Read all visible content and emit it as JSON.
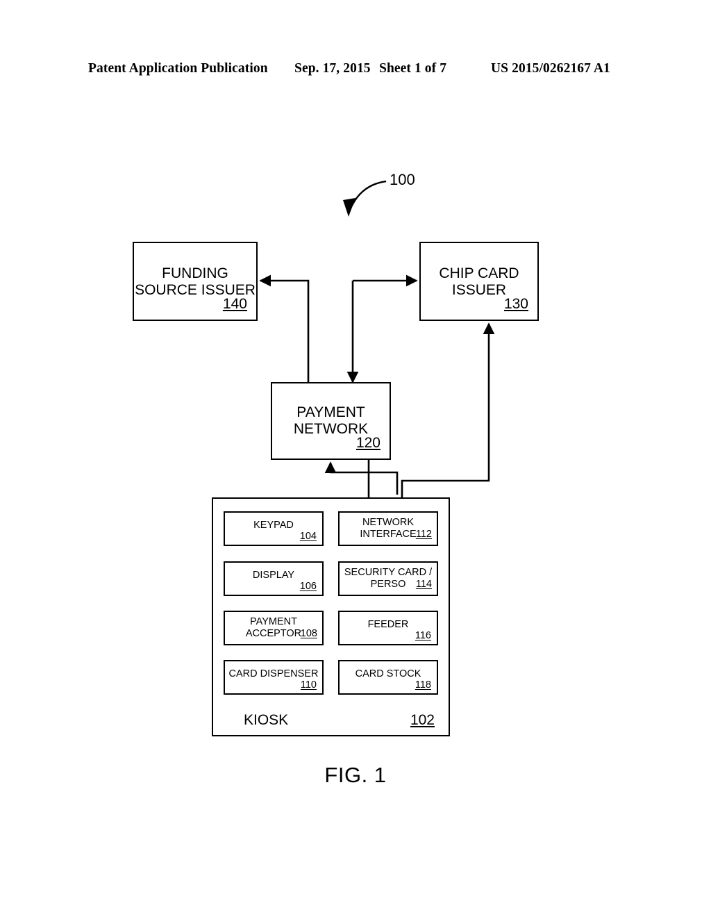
{
  "header": {
    "publication": "Patent Application Publication",
    "date": "Sep. 17, 2015",
    "sheet": "Sheet 1 of 7",
    "number": "US 2015/0262167 A1"
  },
  "figure": {
    "caption": "FIG. 1",
    "system_callout": "100"
  },
  "blocks": {
    "funding_source_issuer": {
      "label": "FUNDING\nSOURCE ISSUER",
      "ref": "140"
    },
    "chip_card_issuer": {
      "label": "CHIP CARD\nISSUER",
      "ref": "130"
    },
    "payment_network": {
      "label": "PAYMENT\nNETWORK",
      "ref": "120"
    },
    "kiosk": {
      "label": "KIOSK",
      "ref": "102"
    }
  },
  "kiosk_components": [
    {
      "label": "KEYPAD",
      "ref": "104",
      "column": "left",
      "row": 1
    },
    {
      "label": "DISPLAY",
      "ref": "106",
      "column": "left",
      "row": 2
    },
    {
      "label": "PAYMENT\nACCEPTOR",
      "ref": "108",
      "column": "left",
      "row": 3
    },
    {
      "label": "CARD DISPENSER",
      "ref": "110",
      "column": "left",
      "row": 4
    },
    {
      "label": "NETWORK\nINTERFACE",
      "ref": "112",
      "column": "right",
      "row": 1
    },
    {
      "label": "SECURITY CARD /\nPERSO",
      "ref": "114",
      "column": "right",
      "row": 2
    },
    {
      "label": "FEEDER",
      "ref": "116",
      "column": "right",
      "row": 3
    },
    {
      "label": "CARD STOCK",
      "ref": "118",
      "column": "right",
      "row": 4
    }
  ],
  "connections": [
    {
      "from": "payment_network",
      "to": "funding_source_issuer",
      "direction": "up-left"
    },
    {
      "from": "payment_network",
      "to": "chip_card_issuer",
      "direction": "up-right"
    },
    {
      "from": "kiosk_network_interface",
      "to": "payment_network",
      "direction": "up"
    },
    {
      "from": "payment_network",
      "to": "kiosk_network_interface",
      "direction": "down"
    },
    {
      "from": "kiosk_network_interface",
      "to": "chip_card_issuer",
      "direction": "up-right"
    }
  ],
  "style": {
    "line_color": "#000000",
    "background": "#ffffff"
  }
}
